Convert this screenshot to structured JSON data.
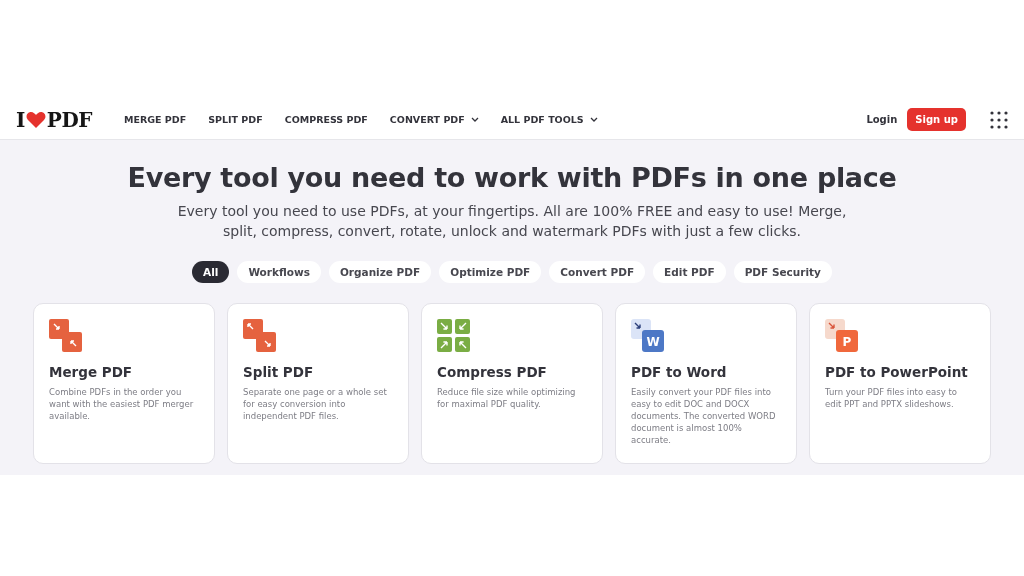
{
  "logo": {
    "left": "I",
    "right": "PDF"
  },
  "nav": [
    {
      "label": "MERGE PDF",
      "dropdown": false
    },
    {
      "label": "SPLIT PDF",
      "dropdown": false
    },
    {
      "label": "COMPRESS PDF",
      "dropdown": false
    },
    {
      "label": "CONVERT PDF",
      "dropdown": true
    },
    {
      "label": "ALL PDF TOOLS",
      "dropdown": true
    }
  ],
  "login": "Login",
  "signup": "Sign up",
  "hero": {
    "title": "Every tool you need to work with PDFs in one place",
    "subtitle": "Every tool you need to use PDFs, at your fingertips. All are 100% FREE and easy to use! Merge, split, compress, convert, rotate, unlock and watermark PDFs with just a few clicks."
  },
  "filters": [
    {
      "label": "All",
      "selected": true
    },
    {
      "label": "Workflows",
      "selected": false
    },
    {
      "label": "Organize PDF",
      "selected": false
    },
    {
      "label": "Optimize PDF",
      "selected": false
    },
    {
      "label": "Convert PDF",
      "selected": false
    },
    {
      "label": "Edit PDF",
      "selected": false
    },
    {
      "label": "PDF Security",
      "selected": false
    }
  ],
  "tools": [
    {
      "kind": "merge",
      "title": "Merge PDF",
      "description": "Combine PDFs in the order you want with the easiest PDF merger available."
    },
    {
      "kind": "split",
      "title": "Split PDF",
      "description": "Separate one page or a whole set for easy conversion into independent PDF files."
    },
    {
      "kind": "compress",
      "title": "Compress PDF",
      "description": "Reduce file size while optimizing for maximal PDF quality."
    },
    {
      "kind": "word",
      "icon_letter": "W",
      "title": "PDF to Word",
      "description": "Easily convert your PDF files into easy to edit DOC and DOCX documents. The converted WORD document is almost 100% accurate."
    },
    {
      "kind": "powerpoint",
      "icon_letter": "P",
      "title": "PDF to PowerPoint",
      "description": "Turn your PDF files into easy to edit PPT and PPTX slideshows."
    }
  ]
}
